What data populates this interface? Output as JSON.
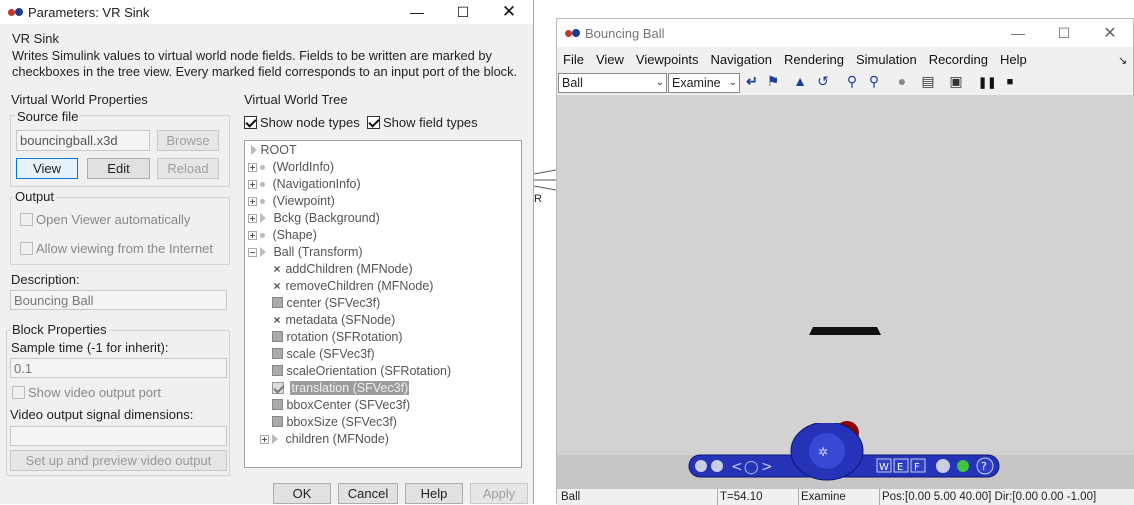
{
  "dialog": {
    "title": "Parameters: VR Sink",
    "block_name": "VR Sink",
    "description_text": "Writes Simulink values to virtual world node fields. Fields to be written are marked by checkboxes in the tree view. Every marked field corresponds to an input port of the block.",
    "vwp": {
      "heading": "Virtual World Properties",
      "source_file_label": "Source file",
      "source_file_value": "bouncingball.x3d",
      "browse": "Browse",
      "view": "View",
      "edit": "Edit",
      "reload": "Reload",
      "output_label": "Output",
      "open_viewer": "Open Viewer automatically",
      "allow_internet": "Allow viewing from the Internet",
      "desc_label": "Description:",
      "desc_value": "Bouncing Ball"
    },
    "block_props": {
      "heading": "Block Properties",
      "sample_label": "Sample time (-1 for inherit):",
      "sample_value": "0.1",
      "show_video": "Show video output port",
      "video_dims_label": "Video output signal dimensions:",
      "video_dims_value": "",
      "setup_button": "Set up and preview video output"
    },
    "tree": {
      "heading": "Virtual World Tree",
      "show_node_types": "Show node types",
      "show_field_types": "Show field types",
      "nodes": [
        "ROOT",
        "(WorldInfo)",
        "(NavigationInfo)",
        "(Viewpoint)",
        "Bckg (Background)",
        "(Shape)",
        "Ball (Transform)",
        "addChildren (MFNode)",
        "removeChildren (MFNode)",
        "center (SFVec3f)",
        "metadata (SFNode)",
        "rotation (SFRotation)",
        "scale (SFVec3f)",
        "scaleOrientation (SFRotation)",
        "translation (SFVec3f)",
        "bboxCenter (SFVec3f)",
        "bboxSize (SFVec3f)",
        "children (MFNode)"
      ]
    },
    "buttons": {
      "ok": "OK",
      "cancel": "Cancel",
      "help": "Help",
      "apply": "Apply"
    }
  },
  "background_block_letter": "R",
  "viewer": {
    "title": "Bouncing Ball",
    "menu": [
      "File",
      "View",
      "Viewpoints",
      "Navigation",
      "Rendering",
      "Simulation",
      "Recording",
      "Help"
    ],
    "viewpoint_value": "Ball",
    "nav_mode_value": "Examine",
    "status": {
      "viewpoint": "Ball",
      "time": "T=54.10",
      "mode": "Examine",
      "pos": "Pos:[0.00 5.00 40.00] Dir:[0.00 0.00 -1.00]"
    },
    "nav_panel_letters": {
      "w": "W",
      "e": "E",
      "f": "F",
      "help": "?"
    }
  },
  "colors": {
    "accent": "#1a3f9c",
    "nav_blue": "#2433b8",
    "ball_red": "#8b0000"
  }
}
